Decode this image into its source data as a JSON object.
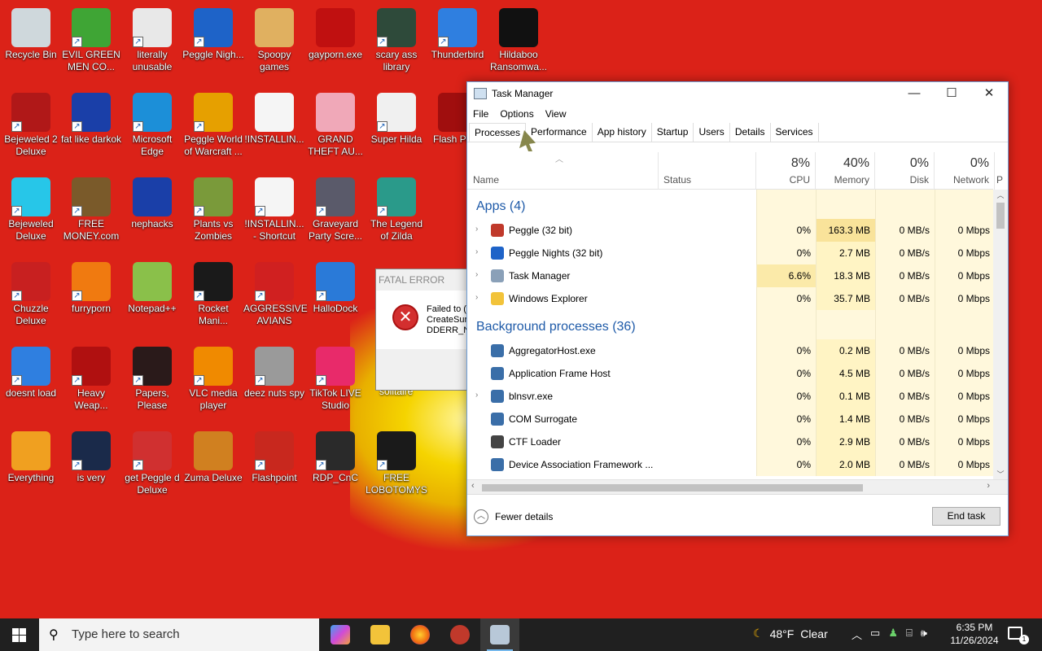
{
  "desktop": {
    "icons": [
      {
        "label": "Recycle Bin",
        "color": "#cfd8dc",
        "shortcut": false
      },
      {
        "label": "EVIL GREEN MEN CO...",
        "color": "#3fa535",
        "shortcut": true
      },
      {
        "label": "literally unusable",
        "color": "#e8e8e8",
        "shortcut": true
      },
      {
        "label": "Peggle Nigh...",
        "color": "#1e63c8",
        "shortcut": true
      },
      {
        "label": "Spoopy games",
        "color": "#e0b060",
        "shortcut": false
      },
      {
        "label": "gayporn.exe",
        "color": "#c01010",
        "shortcut": false
      },
      {
        "label": "scary ass library",
        "color": "#2e4a3a",
        "shortcut": true
      },
      {
        "label": "Thunderbird",
        "color": "#2f7fe0",
        "shortcut": true
      },
      {
        "label": "Hildaboo Ransomwa...",
        "color": "#111111",
        "shortcut": false
      },
      {
        "label": "Bejeweled 2 Deluxe",
        "color": "#b01818",
        "shortcut": true
      },
      {
        "label": "fat like darkok",
        "color": "#1a3fa8",
        "shortcut": true
      },
      {
        "label": "Microsoft Edge",
        "color": "#1c8fd8",
        "shortcut": true
      },
      {
        "label": "Peggle World of Warcraft ...",
        "color": "#e6a000",
        "shortcut": true
      },
      {
        "label": "!INSTALLIN...",
        "color": "#f5f5f5",
        "shortcut": false
      },
      {
        "label": "GRAND THEFT AU...",
        "color": "#f0a8b8",
        "shortcut": false
      },
      {
        "label": "Super Hilda",
        "color": "#f0f0f0",
        "shortcut": true
      },
      {
        "label": "Flash Pla...",
        "color": "#a00e0e",
        "shortcut": false
      },
      {
        "label": "Bejeweled Deluxe",
        "color": "#27c6e8",
        "shortcut": true
      },
      {
        "label": "FREE MONEY.com",
        "color": "#7a5a2a",
        "shortcut": true
      },
      {
        "label": "nephacks",
        "color": "#1a3fa8",
        "shortcut": false
      },
      {
        "label": "Plants vs Zombies",
        "color": "#7a9a3a",
        "shortcut": true
      },
      {
        "label": "!INSTALLIN... - Shortcut",
        "color": "#f5f5f5",
        "shortcut": true
      },
      {
        "label": "Graveyard Party Scre...",
        "color": "#5a5a6a",
        "shortcut": true
      },
      {
        "label": "The Legend of Zilda",
        "color": "#2a9a8a",
        "shortcut": true
      },
      {
        "label": "Chuzzle Deluxe",
        "color": "#c82020",
        "shortcut": true
      },
      {
        "label": "furryporn",
        "color": "#f07a10",
        "shortcut": true
      },
      {
        "label": "Notepad++",
        "color": "#8ac04a",
        "shortcut": false
      },
      {
        "label": "Rocket Mani...",
        "color": "#1a1a1a",
        "shortcut": true
      },
      {
        "label": "AGGRESSIVE AVIANS",
        "color": "#d02020",
        "shortcut": true
      },
      {
        "label": "HalloDock",
        "color": "#2a7ad8",
        "shortcut": true
      },
      {
        "label": "doesnt load",
        "color": "#2f7fe0",
        "shortcut": true
      },
      {
        "label": "Heavy Weap...",
        "color": "#b01010",
        "shortcut": true
      },
      {
        "label": "Papers, Please",
        "color": "#2a1a1a",
        "shortcut": true
      },
      {
        "label": "VLC media player",
        "color": "#f08a00",
        "shortcut": true
      },
      {
        "label": "deez nuts spy",
        "color": "#9a9a9a",
        "shortcut": true
      },
      {
        "label": "TikTok LIVE Studio",
        "color": "#e82a6a",
        "shortcut": true
      },
      {
        "label": "Everything",
        "color": "#f0a020",
        "shortcut": false
      },
      {
        "label": "is very",
        "color": "#1a2a4a",
        "shortcut": true
      },
      {
        "label": "get Peggle d Deluxe",
        "color": "#d03030",
        "shortcut": true
      },
      {
        "label": "Zuma Deluxe",
        "color": "#d08020",
        "shortcut": false
      },
      {
        "label": "Flashpoint",
        "color": "#c8281e",
        "shortcut": true
      },
      {
        "label": "RDP_CnC",
        "color": "#2a2a2a",
        "shortcut": true
      },
      {
        "label": "FREE LOBOTOMYS",
        "color": "#1a1a1a",
        "shortcut": true
      }
    ],
    "hidden_label": "solitaire"
  },
  "fatal_dialog": {
    "title": "FATAL ERROR",
    "message_line1": "Failed to (",
    "message_line2": "CreateSur",
    "message_line3": "DDERR_N("
  },
  "task_manager": {
    "title": "Task Manager",
    "menu": [
      "File",
      "Options",
      "View"
    ],
    "tabs": [
      "Processes",
      "Performance",
      "App history",
      "Startup",
      "Users",
      "Details",
      "Services"
    ],
    "columns": {
      "name": "Name",
      "status": "Status",
      "cpu": {
        "pct": "8%",
        "label": "CPU"
      },
      "memory": {
        "pct": "40%",
        "label": "Memory"
      },
      "disk": {
        "pct": "0%",
        "label": "Disk"
      },
      "network": {
        "pct": "0%",
        "label": "Network"
      },
      "power": "P"
    },
    "apps_group": "Apps (4)",
    "apps": [
      {
        "name": "Peggle (32 bit)",
        "cpu": "0%",
        "mem": "163.3 MB",
        "disk": "0 MB/s",
        "net": "0 Mbps",
        "icon": "#c0392b",
        "expand": true
      },
      {
        "name": "Peggle Nights (32 bit)",
        "cpu": "0%",
        "mem": "2.7 MB",
        "disk": "0 MB/s",
        "net": "0 Mbps",
        "icon": "#1e63c8",
        "expand": true
      },
      {
        "name": "Task Manager",
        "cpu": "6.6%",
        "mem": "18.3 MB",
        "disk": "0 MB/s",
        "net": "0 Mbps",
        "icon": "#8aa0b8",
        "expand": true
      },
      {
        "name": "Windows Explorer",
        "cpu": "0%",
        "mem": "35.7 MB",
        "disk": "0 MB/s",
        "net": "0 Mbps",
        "icon": "#f2c33a",
        "expand": true
      }
    ],
    "bg_group": "Background processes (36)",
    "background": [
      {
        "name": "AggregatorHost.exe",
        "cpu": "0%",
        "mem": "0.2 MB",
        "disk": "0 MB/s",
        "net": "0 Mbps",
        "icon": "#3a6ea8",
        "expand": false
      },
      {
        "name": "Application Frame Host",
        "cpu": "0%",
        "mem": "4.5 MB",
        "disk": "0 MB/s",
        "net": "0 Mbps",
        "icon": "#3a6ea8",
        "expand": false
      },
      {
        "name": "blnsvr.exe",
        "cpu": "0%",
        "mem": "0.1 MB",
        "disk": "0 MB/s",
        "net": "0 Mbps",
        "icon": "#3a6ea8",
        "expand": true
      },
      {
        "name": "COM Surrogate",
        "cpu": "0%",
        "mem": "1.4 MB",
        "disk": "0 MB/s",
        "net": "0 Mbps",
        "icon": "#3a6ea8",
        "expand": false
      },
      {
        "name": "CTF Loader",
        "cpu": "0%",
        "mem": "2.9 MB",
        "disk": "0 MB/s",
        "net": "0 Mbps",
        "icon": "#444",
        "expand": false
      },
      {
        "name": "Device Association Framework ...",
        "cpu": "0%",
        "mem": "2.0 MB",
        "disk": "0 MB/s",
        "net": "0 Mbps",
        "icon": "#3a6ea8",
        "expand": false
      }
    ],
    "fewer_details": "Fewer details",
    "end_task": "End task"
  },
  "taskbar": {
    "search_placeholder": "Type here to search",
    "weather_temp": "48°F",
    "weather_desc": "Clear",
    "time": "6:35 PM",
    "date": "11/26/2024"
  }
}
